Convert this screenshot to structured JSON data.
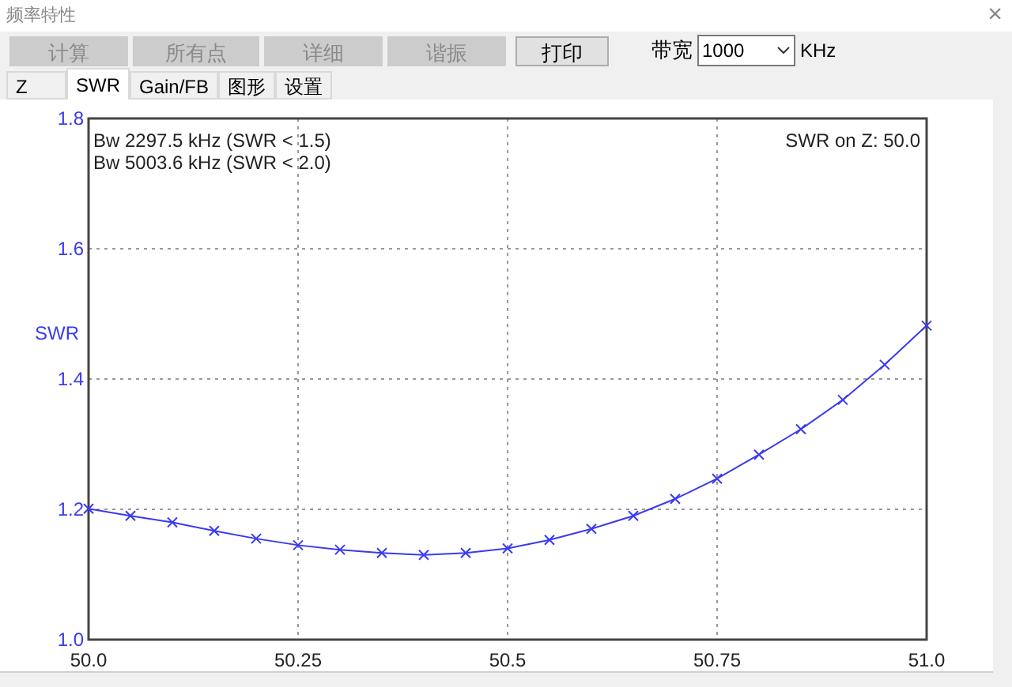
{
  "window": {
    "title": "频率特性",
    "close": "×"
  },
  "toolbar": {
    "buttons": [
      {
        "label": "计算",
        "disabled": true
      },
      {
        "label": "所有点",
        "disabled": true
      },
      {
        "label": "详细",
        "disabled": true
      },
      {
        "label": "谐振",
        "disabled": true
      },
      {
        "label": "打印",
        "disabled": false
      }
    ],
    "bandwidth": {
      "label": "带宽",
      "value": "1000",
      "unit": "KHz"
    }
  },
  "tabs": [
    {
      "label": "Z",
      "selected": false
    },
    {
      "label": "SWR",
      "selected": true
    },
    {
      "label": "Gain/FB",
      "selected": false
    },
    {
      "label": "图形",
      "selected": false
    },
    {
      "label": "设置",
      "selected": false
    }
  ],
  "chart": {
    "notes": [
      "Bw 2297.5 kHz (SWR < 1.5)",
      "Bw 5003.6 kHz (SWR < 2.0)"
    ],
    "z_note": "SWR on Z: 50.0",
    "chart_data": {
      "type": "line",
      "ylabel": "SWR",
      "x": [
        50.0,
        50.05,
        50.1,
        50.15,
        50.2,
        50.25,
        50.3,
        50.35,
        50.4,
        50.45,
        50.5,
        50.55,
        50.6,
        50.65,
        50.7,
        50.75,
        50.8,
        50.85,
        50.9,
        50.95,
        51.0
      ],
      "grid": true,
      "series": [
        {
          "marker": "x",
          "color": "#3a3af0",
          "values": [
            1.201,
            1.19,
            1.18,
            1.167,
            1.155,
            1.145,
            1.138,
            1.133,
            1.13,
            1.133,
            1.14,
            1.153,
            1.17,
            1.19,
            1.216,
            1.247,
            1.284,
            1.323,
            1.368,
            1.422,
            1.482
          ]
        }
      ],
      "xlim": [
        50.0,
        51.0
      ],
      "ylim": [
        1.0,
        1.8
      ],
      "xticks": [
        {
          "value": 50.0,
          "label": "50.0"
        },
        {
          "value": 50.25,
          "label": "50.25"
        },
        {
          "value": 50.5,
          "label": "50.5"
        },
        {
          "value": 50.75,
          "label": "50.75"
        },
        {
          "value": 51.0,
          "label": "51.0"
        }
      ],
      "yticks": [
        {
          "value": 1.0,
          "label": "1.0"
        },
        {
          "value": 1.2,
          "label": "1.2"
        },
        {
          "value": 1.4,
          "label": "1.4"
        },
        {
          "value": 1.6,
          "label": "1.6"
        },
        {
          "value": 1.8,
          "label": "1.8"
        }
      ]
    }
  }
}
